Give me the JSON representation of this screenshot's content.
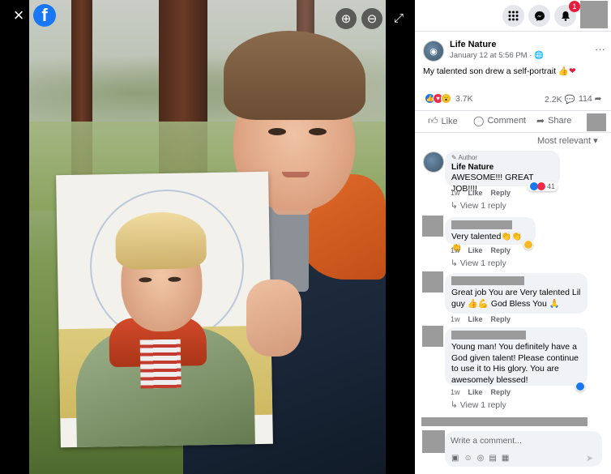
{
  "viewer": {
    "close_icon": "×",
    "logo_letter": "f",
    "zoom_in_icon": "⊕",
    "zoom_out_icon": "⊖",
    "fullscreen_icon": "⤢"
  },
  "topbar": {
    "notification_count": "1"
  },
  "post": {
    "page_name": "Life Nature",
    "time": "January 12 at 5:56 PM · 🌐",
    "more_icon": "···",
    "caption": "My talented son drew a self-portrait",
    "caption_emoji": "👍",
    "caption_heart": "❤",
    "reaction_count": "3.7K",
    "comment_count": "2.2K 💬",
    "share_count": "114 ➦"
  },
  "actions": {
    "like": "Like",
    "comment": "Comment",
    "share": "Share"
  },
  "sort_label": "Most relevant ▾",
  "comments": [
    {
      "author_tag": "✎ Author",
      "name": "Life Nature",
      "text": "AWESOME!!! GREAT JOB!!!!",
      "time": "1w",
      "like": "Like",
      "reply": "Reply",
      "reaction_count": "41",
      "view_reply": "↳ View 1 reply"
    },
    {
      "text": "Very talented👏👏👏",
      "time": "1w",
      "like": "Like",
      "reply": "Reply",
      "view_reply": "↳ View 1 reply"
    },
    {
      "text": "Great job You are Very talented Lil guy 👍💪 God Bless You 🙏",
      "time": "1w",
      "like": "Like",
      "reply": "Reply"
    },
    {
      "text": "Young man! You definitely have a God given talent! Please continue to use it to His glory. You are awesomely blessed!",
      "time": "1w",
      "like": "Like",
      "reply": "Reply",
      "view_reply": "↳ View 1 reply"
    }
  ],
  "compose": {
    "placeholder": "Write a comment..."
  },
  "colors": {
    "facebook_blue": "#1877f2",
    "badge_red": "#e41e3f",
    "bubble_gray": "#f0f2f5",
    "redacted_gray": "#9b9b9b"
  }
}
